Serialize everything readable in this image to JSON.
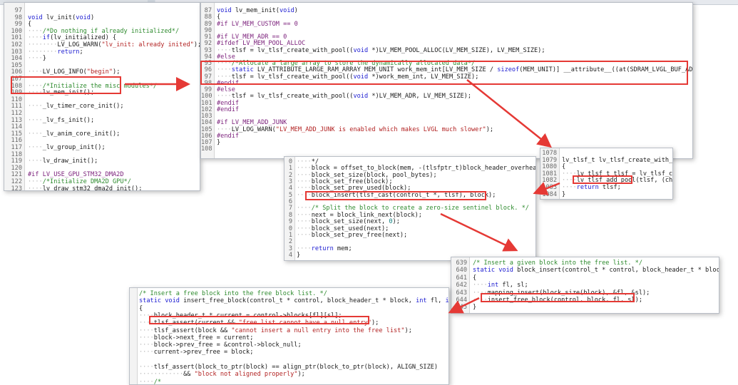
{
  "panel1": {
    "lines": [
      {
        "n": "97",
        "t": ""
      },
      {
        "n": "98",
        "t": "void lv_init(void)"
      },
      {
        "n": "99",
        "t": "{"
      },
      {
        "n": "100",
        "t": "    /*Do nothing if already initialized*/"
      },
      {
        "n": "101",
        "t": "    if(lv_initialized) {"
      },
      {
        "n": "102",
        "t": "        LV_LOG_WARN(\"lv_init: already inited\");"
      },
      {
        "n": "103",
        "t": "        return;"
      },
      {
        "n": "104",
        "t": "    }"
      },
      {
        "n": "105",
        "t": ""
      },
      {
        "n": "106",
        "t": "    LV_LOG_INFO(\"begin\");"
      },
      {
        "n": "107",
        "t": ""
      },
      {
        "n": "108",
        "t": "    /*Initialize the misc modules*/"
      },
      {
        "n": "109",
        "t": "    lv_mem_init();"
      },
      {
        "n": "110",
        "t": ""
      },
      {
        "n": "111",
        "t": "    _lv_timer_core_init();"
      },
      {
        "n": "112",
        "t": ""
      },
      {
        "n": "113",
        "t": "    _lv_fs_init();"
      },
      {
        "n": "114",
        "t": ""
      },
      {
        "n": "115",
        "t": "    _lv_anim_core_init();"
      },
      {
        "n": "116",
        "t": ""
      },
      {
        "n": "117",
        "t": "    _lv_group_init();"
      },
      {
        "n": "118",
        "t": ""
      },
      {
        "n": "119",
        "t": "    lv_draw_init();"
      },
      {
        "n": "120",
        "t": ""
      },
      {
        "n": "121",
        "t": "#if LV_USE_GPU_STM32_DMA2D"
      },
      {
        "n": "122",
        "t": "    /*Initialize DMA2D GPU*/"
      },
      {
        "n": "123",
        "t": "    lv_draw_stm32_dma2d_init();"
      }
    ]
  },
  "panel2": {
    "lines": [
      {
        "n": "87",
        "t": "void lv_mem_init(void)"
      },
      {
        "n": "88",
        "t": "{"
      },
      {
        "n": "89",
        "t": "#if LV_MEM_CUSTOM == 0"
      },
      {
        "n": "90",
        "t": ""
      },
      {
        "n": "91",
        "t": "#if LV_MEM_ADR == 0"
      },
      {
        "n": "92",
        "t": "#ifdef LV_MEM_POOL_ALLOC"
      },
      {
        "n": "93",
        "t": "    tlsf = lv_tlsf_create_with_pool((void *)LV_MEM_POOL_ALLOC(LV_MEM_SIZE), LV_MEM_SIZE);"
      },
      {
        "n": "94",
        "t": "#else"
      },
      {
        "n": "95",
        "t": "    /*Allocate a large array to store the dynamically allocated data*/"
      },
      {
        "n": "96",
        "t": "    static LV_ATTRIBUTE_LARGE_RAM_ARRAY MEM_UNIT work_mem_int[LV_MEM_SIZE / sizeof(MEM_UNIT)] __attribute__((at(SDRAM_LVGL_BUF_ADDR)));"
      },
      {
        "n": "97",
        "t": "    tlsf = lv_tlsf_create_with_pool((void *)work_mem_int, LV_MEM_SIZE);"
      },
      {
        "n": "98",
        "t": "#endif"
      },
      {
        "n": "99",
        "t": "#else"
      },
      {
        "n": "100",
        "t": "    tlsf = lv_tlsf_create_with_pool((void *)LV_MEM_ADR, LV_MEM_SIZE);"
      },
      {
        "n": "101",
        "t": "#endif"
      },
      {
        "n": "102",
        "t": "#endif"
      },
      {
        "n": "103",
        "t": ""
      },
      {
        "n": "104",
        "t": "#if LV_MEM_ADD_JUNK"
      },
      {
        "n": "105",
        "t": "    LV_LOG_WARN(\"LV_MEM_ADD_JUNK is enabled which makes LVGL much slower\");"
      },
      {
        "n": "106",
        "t": "#endif"
      },
      {
        "n": "107",
        "t": "}"
      },
      {
        "n": "108",
        "t": ""
      }
    ]
  },
  "panel3": {
    "lines": [
      {
        "n": "1078",
        "t": ""
      },
      {
        "n": "1079",
        "t": "lv_tlsf_t lv_tlsf_create_with_po"
      },
      {
        "n": "1080",
        "t": "{"
      },
      {
        "n": "1081",
        "t": "    lv_tlsf_t tlsf = lv_tlsf_cre"
      },
      {
        "n": "1082",
        "t": "    lv_tlsf_add_pool(tlsf, (cha"
      },
      {
        "n": "1083",
        "t": "    return tlsf;"
      },
      {
        "n": "1084",
        "t": "}"
      }
    ]
  },
  "panel4": {
    "lines": [
      {
        "n": "0",
        "t": "    */"
      },
      {
        "n": "1",
        "t": "    block = offset_to_block(mem, -(tlsfptr_t)block_header_overhead);"
      },
      {
        "n": "2",
        "t": "    block_set_size(block, pool_bytes);"
      },
      {
        "n": "3",
        "t": "    block_set_free(block);"
      },
      {
        "n": "4",
        "t": "    block_set_prev_used(block);"
      },
      {
        "n": "5",
        "t": "    block_insert(tlsf_cast(control_t *, tlsf), block);"
      },
      {
        "n": "6",
        "t": ""
      },
      {
        "n": "7",
        "t": "    /* Split the block to create a zero-size sentinel block. */"
      },
      {
        "n": "8",
        "t": "    next = block_link_next(block);"
      },
      {
        "n": "9",
        "t": "    block_set_size(next, 0);"
      },
      {
        "n": "0",
        "t": "    block_set_used(next);"
      },
      {
        "n": "1",
        "t": "    block_set_prev_free(next);"
      },
      {
        "n": "2",
        "t": ""
      },
      {
        "n": "3",
        "t": "    return mem;"
      },
      {
        "n": "4",
        "t": "}"
      }
    ]
  },
  "panel5": {
    "lines": [
      {
        "n": "639",
        "t": "/* Insert a given block into the free list. */"
      },
      {
        "n": "640",
        "t": "static void block_insert(control_t * control, block_header_t * block)"
      },
      {
        "n": "641",
        "t": "{"
      },
      {
        "n": "642",
        "t": "    int fl, sl;"
      },
      {
        "n": "643",
        "t": "    mapping_insert(block_size(block), &fl, &sl);"
      },
      {
        "n": "644",
        "t": "    insert_free_block(control, block, fl, sl);"
      },
      {
        "n": "645",
        "t": "}"
      }
    ]
  },
  "panel6": {
    "lines": [
      {
        "n": "",
        "t": "/* Insert a free block into the free block list. */"
      },
      {
        "n": "",
        "t": "static void insert_free_block(control_t * control, block_header_t * block, int fl, int sl)"
      },
      {
        "n": "",
        "t": "{"
      },
      {
        "n": "",
        "t": "    block_header_t * current = control->blocks[fl][sl];"
      },
      {
        "n": "",
        "t": "    tlsf_assert(current && \"free list cannot have a null entry\");"
      },
      {
        "n": "",
        "t": "    tlsf_assert(block && \"cannot insert a null entry into the free list\");"
      },
      {
        "n": "",
        "t": "    block->next_free = current;"
      },
      {
        "n": "",
        "t": "    block->prev_free = &control->block_null;"
      },
      {
        "n": "",
        "t": "    current->prev_free = block;"
      },
      {
        "n": "",
        "t": ""
      },
      {
        "n": "",
        "t": "    tlsf_assert(block_to_ptr(block) == align_ptr(block_to_ptr(block), ALIGN_SIZE)"
      },
      {
        "n": "",
        "t": "            && \"block not aligned properly\");"
      },
      {
        "n": "",
        "t": "    /*"
      }
    ]
  },
  "colors": {
    "highlight_box": "#e53935",
    "arrow": "#e53935",
    "keyword": "#1a1ad1",
    "comment": "#2e8b2e",
    "string": "#b22222",
    "preprocessor": "#7a1e7a"
  }
}
